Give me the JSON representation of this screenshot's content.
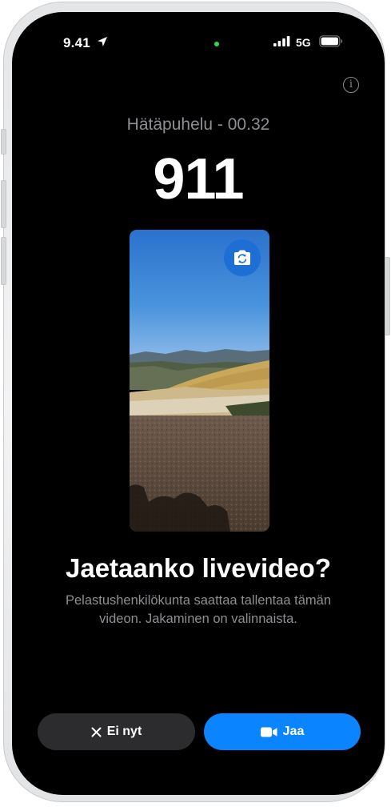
{
  "status_bar": {
    "time": "9.41",
    "network": "5G",
    "location_icon": "location-arrow-icon",
    "signal_icon": "cellular-signal-icon",
    "battery_icon": "battery-icon",
    "camera_indicator_color": "#32d74b"
  },
  "call": {
    "info_glyph": "i",
    "status": "Hätäpuhelu - 00.32",
    "number": "911"
  },
  "video_preview": {
    "flip_camera_icon": "camera-flip-icon"
  },
  "prompt": {
    "title": "Jaetaanko livevideo?",
    "body": "Pelastushenkilökunta saattaa tallentaa tämän videon. Jakaminen on valinnaista."
  },
  "actions": {
    "dismiss_label": "Ei nyt",
    "dismiss_icon": "close-icon",
    "share_label": "Jaa",
    "share_icon": "video-camera-icon",
    "share_color": "#0a84ff",
    "dismiss_color": "#2c2c2e"
  }
}
